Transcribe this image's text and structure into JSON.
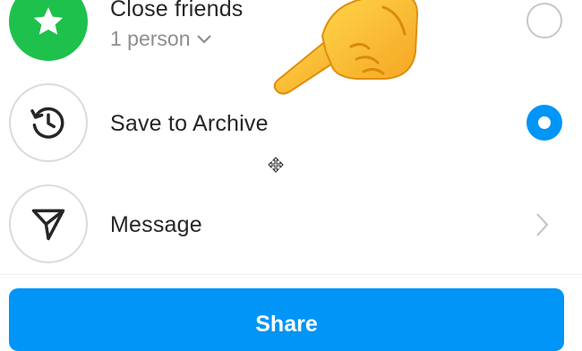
{
  "options": [
    {
      "label": "Close friends",
      "sublabel": "1 person",
      "icon": "star-icon",
      "selector": "radio-off"
    },
    {
      "label": "Save to Archive",
      "icon": "history-icon",
      "selector": "radio-on"
    },
    {
      "label": "Message",
      "icon": "paper-plane-icon",
      "selector": "chevron-right"
    }
  ],
  "share_button": {
    "label": "Share"
  },
  "colors": {
    "close_friends_green": "#1ec14b",
    "accent_blue": "#0095f6",
    "primary_text": "#262626",
    "secondary_text": "#8e8e8e"
  },
  "overlay": {
    "emoji": "backhand-index-pointing-left-emoji",
    "cursor": "move-cursor-icon"
  }
}
